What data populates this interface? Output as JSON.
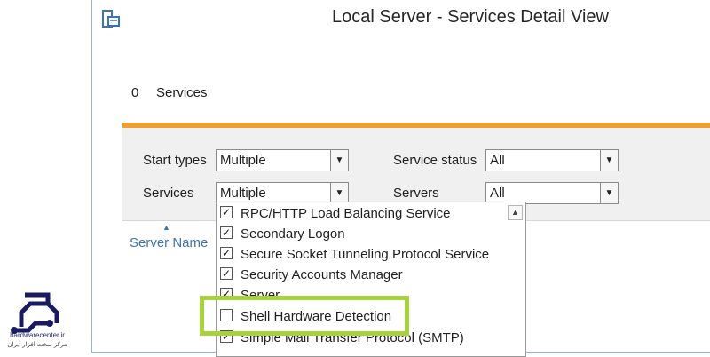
{
  "window": {
    "title": "Local Server - Services Detail View",
    "icon": "server-manager-icon"
  },
  "summary": {
    "count": "0",
    "label": "Services"
  },
  "filters": {
    "start_types_label": "Start types",
    "start_types_value": "Multiple",
    "services_label": "Services",
    "services_value": "Multiple",
    "service_status_label": "Service status",
    "service_status_value": "All",
    "servers_label": "Servers",
    "servers_value": "All"
  },
  "table": {
    "col_server_name": "Server Name"
  },
  "services_dropdown": {
    "items": [
      {
        "label": "RPC/HTTP Load Balancing Service",
        "checked": true
      },
      {
        "label": "Secondary Logon",
        "checked": true
      },
      {
        "label": "Secure Socket Tunneling Protocol Service",
        "checked": true
      },
      {
        "label": "Security Accounts Manager",
        "checked": true
      },
      {
        "label": "Server",
        "checked": true
      },
      {
        "label": "Shell Hardware Detection",
        "checked": false
      },
      {
        "label": "Simple Mail Transfer Protocol (SMTP)",
        "checked": true
      }
    ]
  },
  "watermark": {
    "url": "hardwarecenter.ir",
    "tagline": "مرکز سخت افزار ایران"
  },
  "colors": {
    "accent_orange": "#f0a030",
    "highlight_green": "#a8d23a",
    "link_blue": "#3a74b5"
  }
}
